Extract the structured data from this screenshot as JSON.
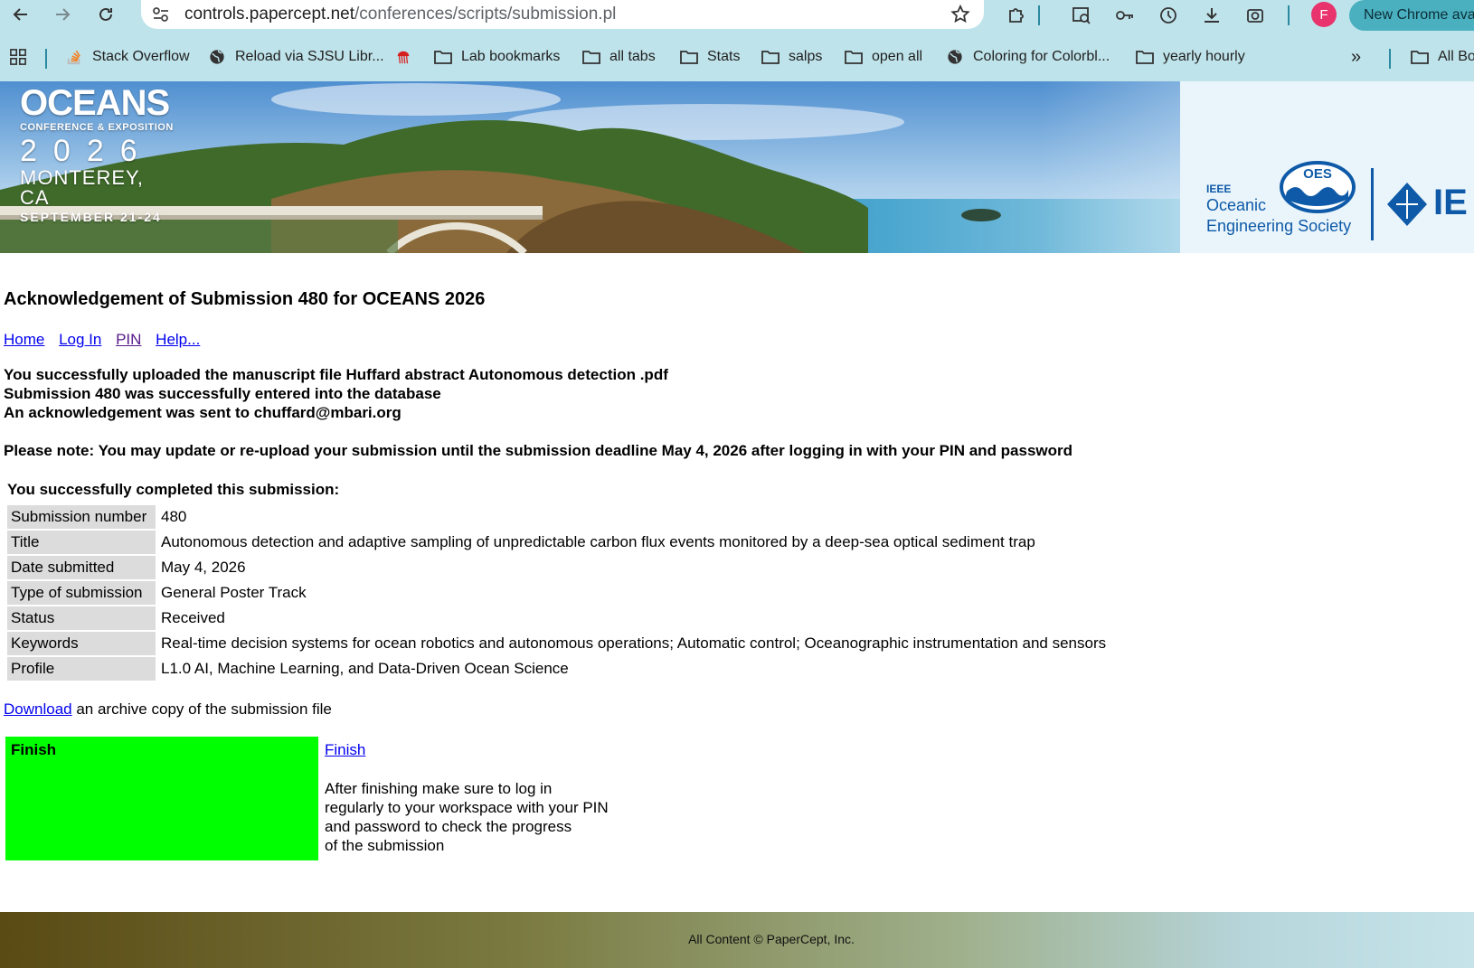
{
  "browser": {
    "url_host": "controls.papercept.net",
    "url_path": "/conferences/scripts/submission.pl",
    "profile_initial": "F",
    "new_chrome_label": "New Chrome ava",
    "bookmarks": [
      {
        "label": "Stack Overflow",
        "icon": "stackoverflow-icon"
      },
      {
        "label": "Reload via SJSU Libr...",
        "icon": "globe-icon"
      },
      {
        "label": "",
        "icon": "jellyfish-icon"
      },
      {
        "label": "Lab bookmarks",
        "icon": "folder-icon"
      },
      {
        "label": "all tabs",
        "icon": "folder-icon"
      },
      {
        "label": "Stats",
        "icon": "folder-icon"
      },
      {
        "label": "salps",
        "icon": "folder-icon"
      },
      {
        "label": "open all",
        "icon": "folder-icon"
      },
      {
        "label": "Coloring for Colorbl...",
        "icon": "globe-icon"
      },
      {
        "label": "yearly hourly",
        "icon": "folder-icon"
      }
    ],
    "all_bookmarks_label": "All Bo"
  },
  "banner": {
    "logo_line1": "OCEANS",
    "logo_line2": "CONFERENCE & EXPOSITION",
    "logo_year": "2026",
    "logo_city": "MONTEREY, CA",
    "logo_dates": "SEPTEMBER 21-24",
    "oes_ieee": "IEEE",
    "oes_line1": "Oceanic",
    "oes_line2": "Engineering Society",
    "oes_badge": "OES",
    "ieee_partial": "IE"
  },
  "page": {
    "title": "Acknowledgement of Submission 480 for OCEANS 2026",
    "nav": {
      "home": "Home",
      "login": "Log In",
      "pin": "PIN",
      "help": "Help..."
    },
    "messages": {
      "uploaded": "You successfully uploaded the manuscript file Huffard abstract Autonomous detection .pdf",
      "entered": "Submission 480 was successfully entered into the database",
      "ack_sent": "An acknowledgement was sent to chuffard@mbari.org",
      "note": "Please note: You may update or re-upload your submission until the submission deadline May 4, 2026 after logging in with your PIN and password"
    },
    "summary": {
      "caption": "You successfully completed this submission:",
      "rows": [
        {
          "key": "Submission number",
          "value": "480"
        },
        {
          "key": "Title",
          "value": "Autonomous detection and adaptive sampling of unpredictable carbon flux events monitored by a deep-sea optical sediment trap"
        },
        {
          "key": "Date submitted",
          "value": "May 4, 2026"
        },
        {
          "key": "Type of submission",
          "value": "General Poster Track"
        },
        {
          "key": "Status",
          "value": "Received"
        },
        {
          "key": "Keywords",
          "value": "Real-time decision systems for ocean robotics and autonomous operations; Automatic control; Oceanographic instrumentation and sensors"
        },
        {
          "key": "Profile",
          "value": "L1.0 AI, Machine Learning, and Data-Driven Ocean Science"
        }
      ]
    },
    "download": {
      "link": "Download",
      "rest": " an archive copy of the submission file"
    },
    "finish": {
      "box_label": "Finish",
      "link": "Finish",
      "note_lines": [
        "After finishing make sure to log in",
        "regularly to your workspace with your PIN",
        "and password to check the progress",
        "of the submission"
      ]
    },
    "footer": "All Content © PaperCept, Inc."
  },
  "colors": {
    "chrome_bg": "#bfe3ea",
    "finish_green": "#00ff00",
    "link_blue": "#0000ee",
    "link_visited": "#551a8b",
    "key_cell_gray": "#dcdcdc"
  }
}
